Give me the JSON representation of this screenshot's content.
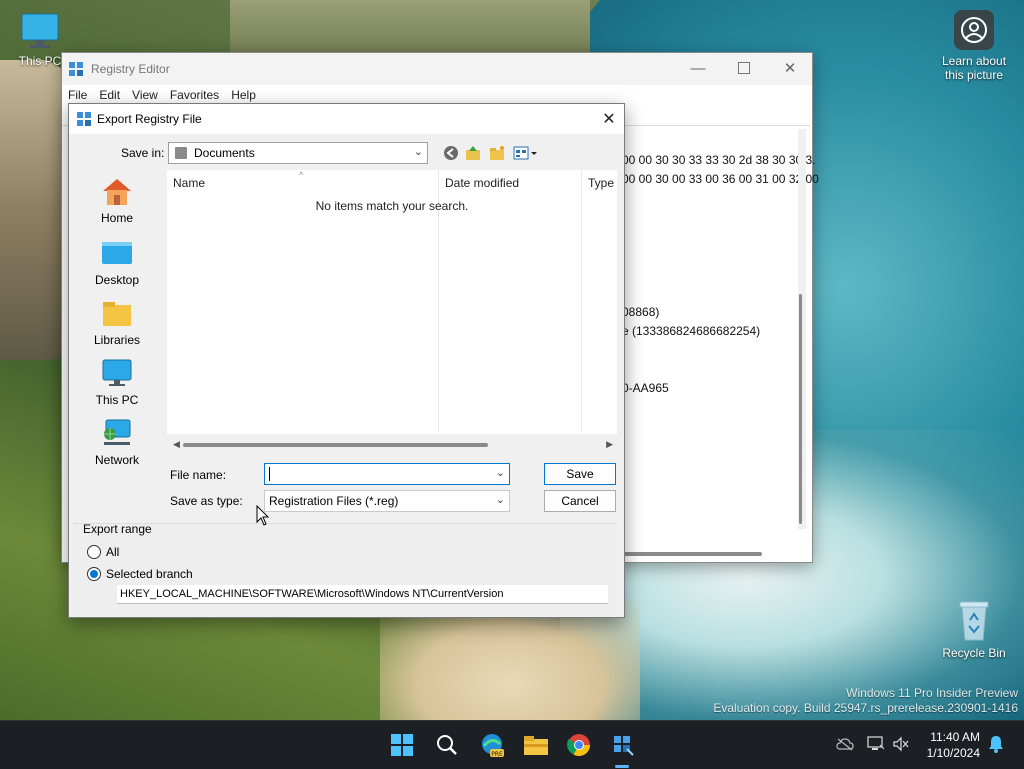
{
  "desktop": {
    "icons": {
      "this_pc": "This PC",
      "learn": "Learn about this picture",
      "recycle_bin": "Recycle Bin"
    },
    "watermark": {
      "line1": "Windows 11 Pro Insider Preview",
      "line2": "Evaluation copy. Build 25947.rs_prerelease.230901-1416"
    }
  },
  "regedit": {
    "title": "Registry Editor",
    "menu": [
      "File",
      "Edit",
      "View",
      "Favorites",
      "Help"
    ],
    "values": [
      "00 00 30 30 33 33 30 2d 38 30 30 3.",
      "00 00 30 00 33 00 36 00 31 00 32 00",
      "08868)",
      "e (133386824686682254)",
      "0-AA965"
    ]
  },
  "dialog": {
    "title": "Export Registry File",
    "save_in_label": "Save in:",
    "save_in_value": "Documents",
    "places": [
      "Home",
      "Desktop",
      "Libraries",
      "This PC",
      "Network"
    ],
    "columns": [
      "Name",
      "Date modified",
      "Type"
    ],
    "empty_message": "No items match your search.",
    "file_name_label": "File name:",
    "file_name_value": "",
    "save_as_type_label": "Save as type:",
    "save_as_type_value": "Registration Files (*.reg)",
    "save_button": "Save",
    "cancel_button": "Cancel",
    "export_range": {
      "title": "Export range",
      "option_all": "All",
      "option_selected": "Selected branch",
      "selected": "Selected branch",
      "branch_path": "HKEY_LOCAL_MACHINE\\SOFTWARE\\Microsoft\\Windows NT\\CurrentVersion"
    }
  },
  "taskbar": {
    "time": "11:40 AM",
    "date": "1/10/2024",
    "apps": [
      "start-icon",
      "search-icon",
      "edge-pre-icon",
      "file-explorer-icon",
      "chrome-icon",
      "regedit-icon"
    ]
  },
  "colors": {
    "accent": "#0078d4",
    "taskbar": "#1c1f24"
  }
}
